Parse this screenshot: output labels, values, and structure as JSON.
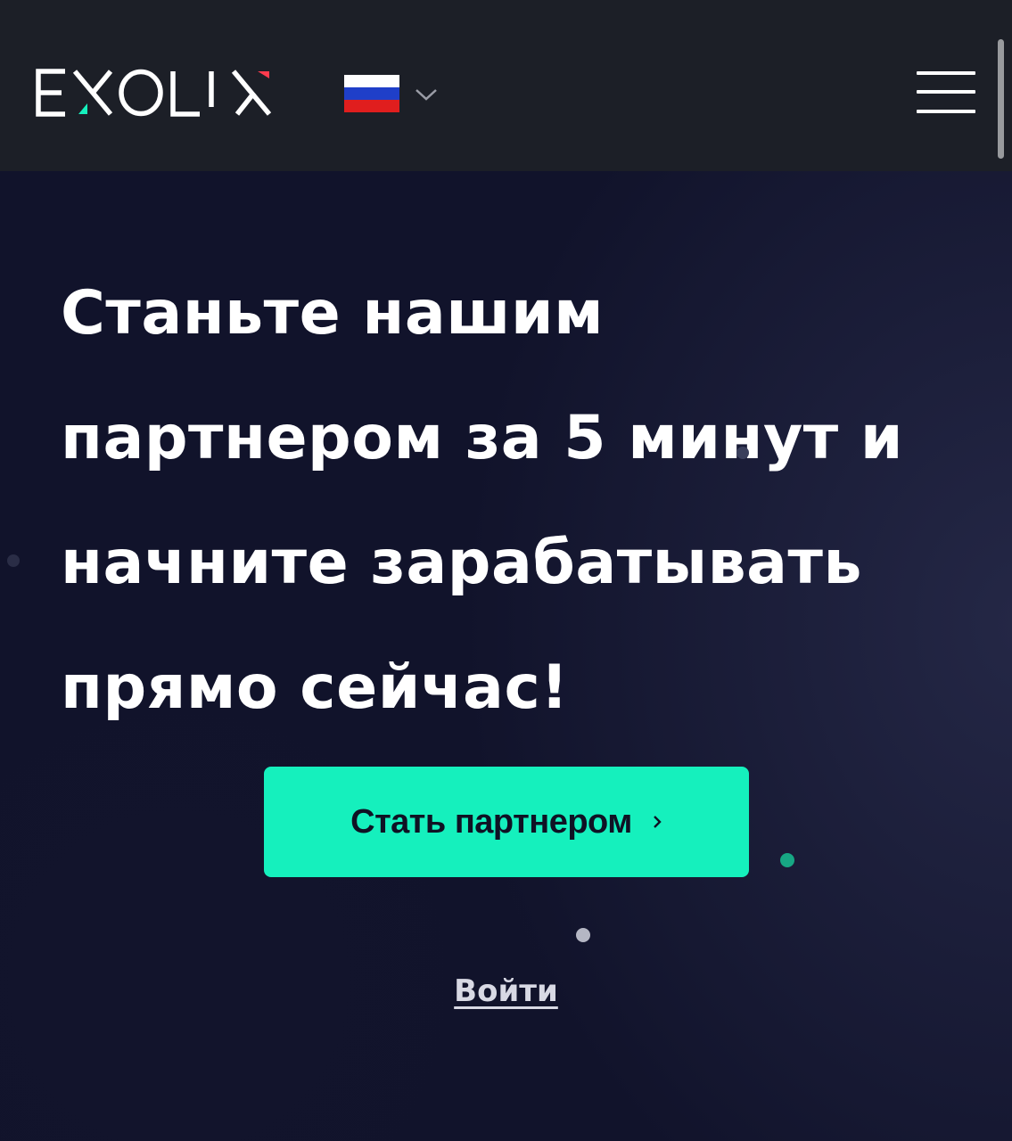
{
  "header": {
    "logo_text": "EXOLIX",
    "language": {
      "selected": "ru",
      "flag_colors": [
        "#ffffff",
        "#1f3fc9",
        "#e01e1e"
      ]
    },
    "menu_icon": "hamburger-icon"
  },
  "hero": {
    "headline": "Станьте нашим партнером за 5 минут и начните зарабатывать прямо сейчас!",
    "cta_label": "Стать партнером",
    "cta_icon": "chevron-right-icon",
    "login_label": "Войти"
  },
  "colors": {
    "header_bg": "#1c1f27",
    "page_bg": "#11132b",
    "accent": "#15f0bd",
    "logo_green": "#15f0bd",
    "logo_red": "#ff3b4e"
  }
}
